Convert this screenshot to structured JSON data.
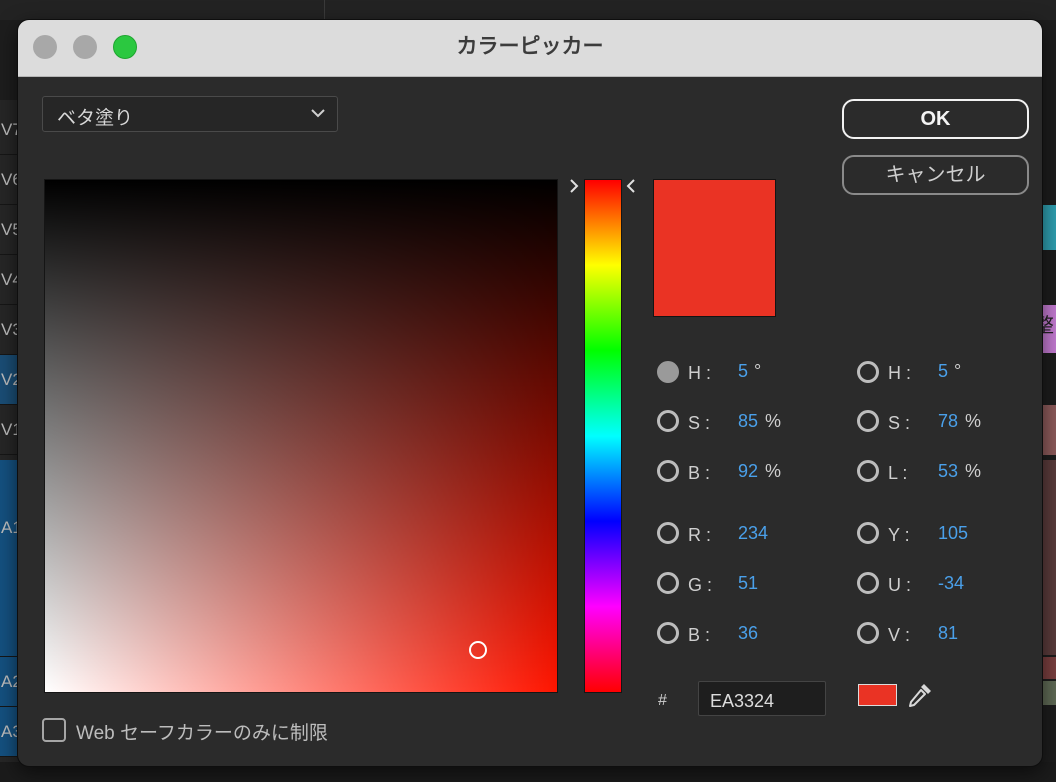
{
  "background": {
    "tracks": [
      "V7",
      "V6",
      "V5",
      "V4",
      "V3",
      "V2",
      "V1",
      "A1",
      "A2",
      "A3"
    ],
    "right_glyph": "整"
  },
  "dialog": {
    "title": "カラーピッカー",
    "fill_type": "ベタ塗り",
    "ok_label": "OK",
    "cancel_label": "キャンセル",
    "current_color": "#EA3324",
    "hue_base_color": "#FF1500",
    "hsb": {
      "h_label": "H :",
      "h_value": "5",
      "h_unit": "°",
      "s_label": "S :",
      "s_value": "85",
      "s_unit": "%",
      "b_label": "B :",
      "b_value": "92",
      "b_unit": "%"
    },
    "hsl": {
      "h_label": "H :",
      "h_value": "5",
      "h_unit": "°",
      "s_label": "S :",
      "s_value": "78",
      "s_unit": "%",
      "l_label": "L :",
      "l_value": "53",
      "l_unit": "%"
    },
    "rgb": {
      "r_label": "R :",
      "r_value": "234",
      "g_label": "G :",
      "g_value": "51",
      "b_label": "B :",
      "b_value": "36"
    },
    "yuv": {
      "y_label": "Y :",
      "y_value": "105",
      "u_label": "U :",
      "u_value": "-34",
      "v_label": "V :",
      "v_value": "81"
    },
    "hex_prefix": "#",
    "hex_value": "EA3324",
    "websafe_label": "Web セーフカラーのみに制限",
    "websafe_checked": false
  }
}
